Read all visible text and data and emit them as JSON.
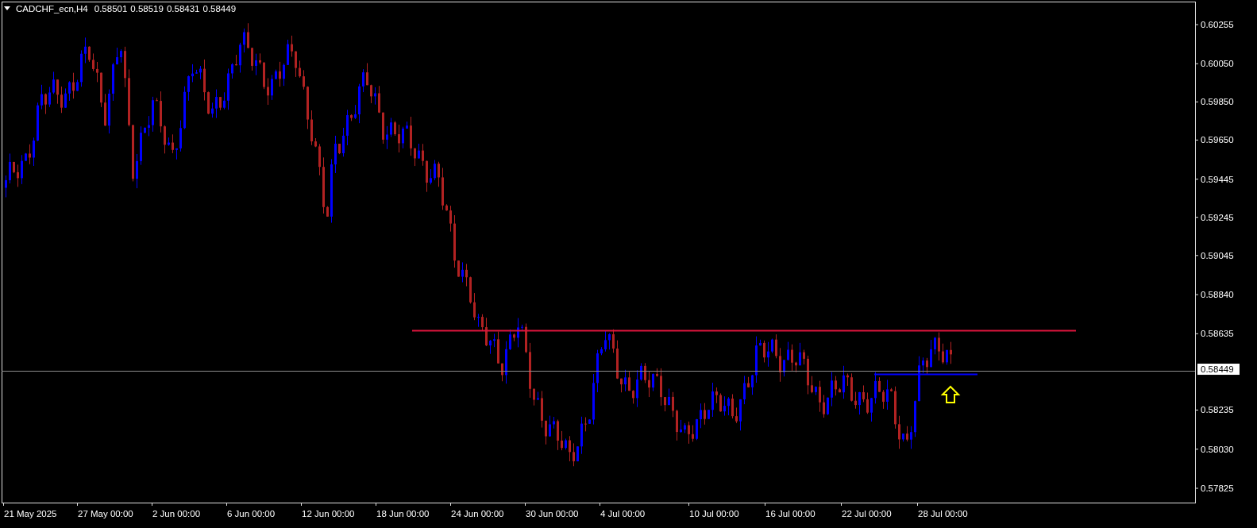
{
  "header": {
    "symbol": "CADCHF_ecn,H4",
    "quotes": [
      "0.58501",
      "0.58519",
      "0.58431",
      "0.58449"
    ]
  },
  "price_axis": {
    "labels": [
      "0.60255",
      "0.60050",
      "0.59850",
      "0.59650",
      "0.59445",
      "0.59245",
      "0.59045",
      "0.58840",
      "0.58635",
      "0.58235",
      "0.58030",
      "0.57825"
    ],
    "current_price": "0.58449"
  },
  "time_axis": {
    "labels": [
      "21 May 2025",
      "27 May 00:00",
      "2 Jun 00:00",
      "6 Jun 00:00",
      "12 Jun 00:00",
      "18 Jun 00:00",
      "24 Jun 00:00",
      "30 Jun 00:00",
      "4 Jul 00:00",
      "10 Jul 00:00",
      "16 Jul 00:00",
      "22 Jul 00:00",
      "28 Jul 00:00"
    ]
  }
}
